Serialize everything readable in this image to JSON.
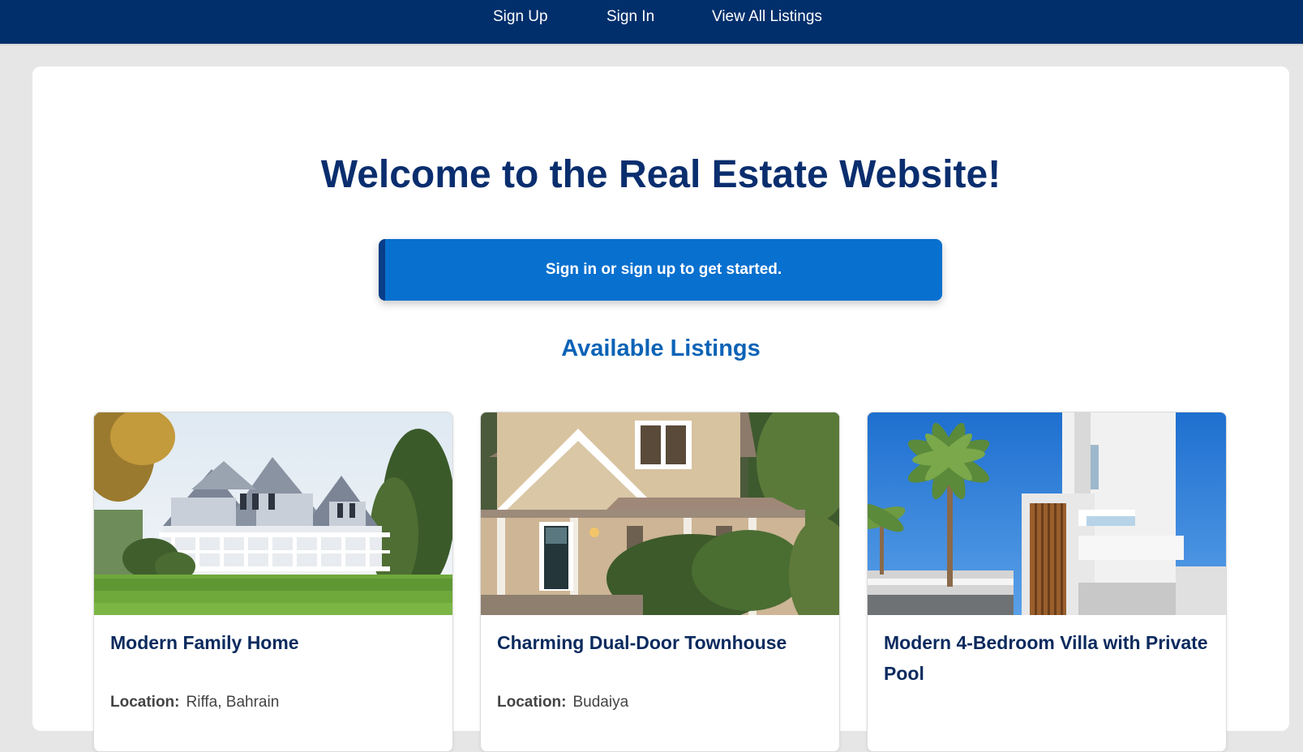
{
  "nav": {
    "sign_up": "Sign Up",
    "sign_in": "Sign In",
    "view_all": "View All Listings"
  },
  "hero": {
    "title": "Welcome to the Real Estate Website!",
    "cta": "Sign in or sign up to get started."
  },
  "listings_section": {
    "title": "Available Listings",
    "location_label": "Location:",
    "items": [
      {
        "title": "Modern Family Home",
        "location": "Riffa, Bahrain"
      },
      {
        "title": "Charming Dual-Door Townhouse",
        "location": "Budaiya"
      },
      {
        "title": "Modern 4-Bedroom Villa with Private Pool",
        "location": ""
      }
    ]
  },
  "colors": {
    "nav_bg": "#002f6c",
    "heading": "#0a2e6e",
    "cta_bg": "#0870cf",
    "section_heading": "#0b63b6"
  }
}
